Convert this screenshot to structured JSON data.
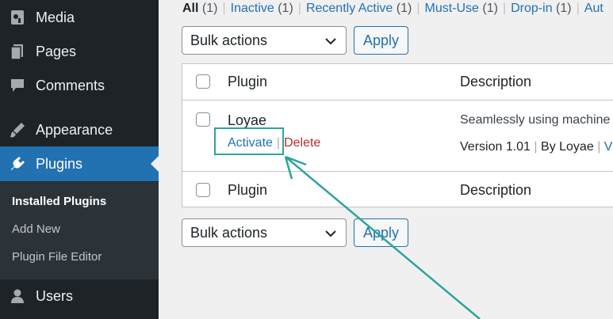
{
  "sidebar": {
    "items": [
      {
        "label": "Media",
        "icon": "media-icon"
      },
      {
        "label": "Pages",
        "icon": "pages-icon"
      },
      {
        "label": "Comments",
        "icon": "comments-icon"
      },
      {
        "label": "Appearance",
        "icon": "appearance-icon"
      },
      {
        "label": "Plugins",
        "icon": "plugins-icon"
      },
      {
        "label": "Users",
        "icon": "users-icon"
      }
    ],
    "submenu": [
      "Installed Plugins",
      "Add New",
      "Plugin File Editor"
    ]
  },
  "filters": {
    "all": "All",
    "all_count": "(1)",
    "inactive": "Inactive",
    "inactive_count": "(1)",
    "recent": "Recently Active",
    "recent_count": "(1)",
    "mustuse": "Must-Use",
    "mustuse_count": "(1)",
    "dropin": "Drop-in",
    "dropin_count": "(1)",
    "auto": "Aut"
  },
  "bulk": {
    "top_label": "Bulk actions",
    "bottom_label": "Bulk actions",
    "apply": "Apply"
  },
  "table": {
    "col_plugin": "Plugin",
    "col_description": "Description",
    "row": {
      "name": "Loyae",
      "activate": "Activate",
      "delete": "Delete",
      "description": "Seamlessly using machine l",
      "version": "Version 1.01",
      "by": "By Loyae",
      "visit": "Vis"
    }
  },
  "colors": {
    "sidebar_bg": "#1d2327",
    "accent": "#2271b1",
    "delete": "#b32d2e",
    "annotation": "#2ba59b"
  }
}
